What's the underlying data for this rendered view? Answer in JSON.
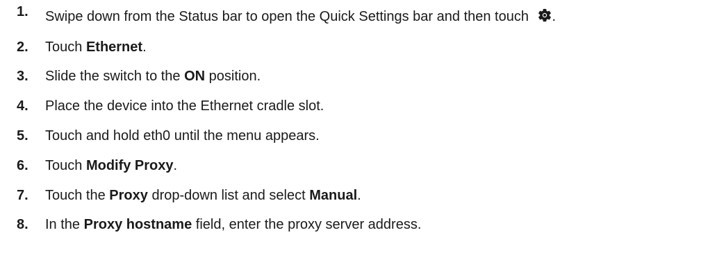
{
  "steps": [
    {
      "number": "1.",
      "parts": [
        {
          "text": "Swipe down from the Status bar to open the Quick Settings bar and then touch ",
          "bold": false
        }
      ],
      "icon": "gear-icon",
      "suffix": "."
    },
    {
      "number": "2.",
      "parts": [
        {
          "text": "Touch ",
          "bold": false
        },
        {
          "text": "Ethernet",
          "bold": true
        },
        {
          "text": ".",
          "bold": false
        }
      ]
    },
    {
      "number": "3.",
      "parts": [
        {
          "text": "Slide the switch to the ",
          "bold": false
        },
        {
          "text": "ON",
          "bold": true
        },
        {
          "text": " position.",
          "bold": false
        }
      ]
    },
    {
      "number": "4.",
      "parts": [
        {
          "text": "Place the device into the Ethernet cradle slot.",
          "bold": false
        }
      ]
    },
    {
      "number": "5.",
      "parts": [
        {
          "text": "Touch and hold eth0 until the menu appears.",
          "bold": false
        }
      ]
    },
    {
      "number": "6.",
      "parts": [
        {
          "text": "Touch ",
          "bold": false
        },
        {
          "text": "Modify Proxy",
          "bold": true
        },
        {
          "text": ".",
          "bold": false
        }
      ]
    },
    {
      "number": "7.",
      "parts": [
        {
          "text": "Touch the ",
          "bold": false
        },
        {
          "text": "Proxy",
          "bold": true
        },
        {
          "text": " drop-down list and select ",
          "bold": false
        },
        {
          "text": "Manual",
          "bold": true
        },
        {
          "text": ".",
          "bold": false
        }
      ]
    },
    {
      "number": "8.",
      "parts": [
        {
          "text": "In the ",
          "bold": false
        },
        {
          "text": "Proxy hostname",
          "bold": true
        },
        {
          "text": " field, enter the proxy server address.",
          "bold": false
        }
      ]
    }
  ]
}
